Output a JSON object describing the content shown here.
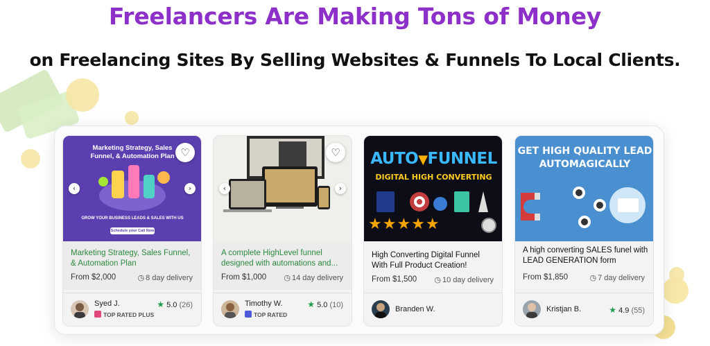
{
  "headline": "Freelancers Are Making Tons of Money",
  "subheadline": "on Freelancing Sites By Selling Websites & Funnels To Local Clients.",
  "icons": {
    "favorite": "heart-icon",
    "prev": "chevron-left-icon",
    "next": "chevron-right-icon",
    "delivery": "clock-icon",
    "rating": "star-icon"
  },
  "colors": {
    "headline": "#8d2fc9",
    "green": "#2c8a3f",
    "star": "#1e9b4b"
  },
  "cards": [
    {
      "thumb": {
        "heading": "Marketing Strategy, Sales Funnel, & Automation Plan",
        "footer_text": "GROW YOUR BUSINESS LEADS & SALES WITH US",
        "cta": "Schedule your Call Now"
      },
      "title": "Marketing Strategy, Sales Funnel, & Automation Plan",
      "price": "From $2,000",
      "delivery": "8 day delivery",
      "seller": "Syed J.",
      "badge": "TOP RATED PLUS",
      "rating": "5.0",
      "reviews": "(26)"
    },
    {
      "thumb": {},
      "title": "A complete HighLevel funnel designed with automations and...",
      "price": "From $1,000",
      "delivery": "14 day delivery",
      "seller": "Timothy W.",
      "badge": "TOP RATED",
      "rating": "5.0",
      "reviews": "(10)"
    },
    {
      "thumb": {
        "line1_a": "AUTO",
        "line1_b": "FUNNEL",
        "line2": "DIGITAL HIGH CONVERTING",
        "stars": "★★★★★"
      },
      "title": "High Converting Digital Funnel With Full Product Creation!",
      "price": "From $1,500",
      "delivery": "10 day delivery",
      "seller": "Branden W.",
      "rating": "",
      "reviews": ""
    },
    {
      "thumb": {
        "line1": "GET HIGH QUALITY LEAD",
        "line2": "AUTOMAGICALLY"
      },
      "title": "A high converting SALES funel with LEAD GENERATION form",
      "price": "From $1,850",
      "delivery": "7 day delivery",
      "seller": "Kristjan B.",
      "rating": "4.9",
      "reviews": "(55)"
    }
  ]
}
